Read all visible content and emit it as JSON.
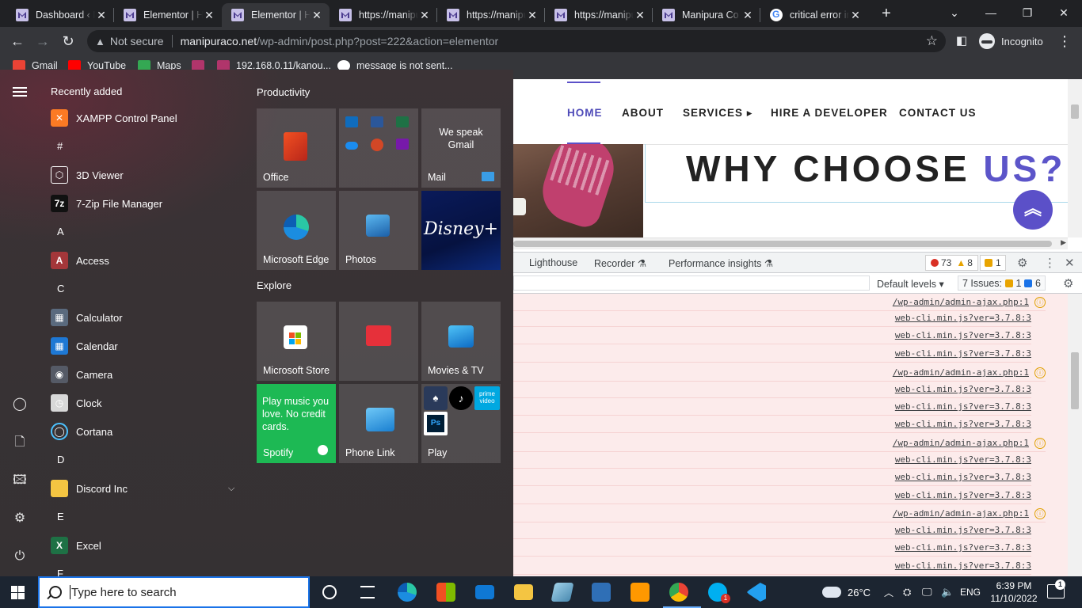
{
  "browser": {
    "tabs": [
      {
        "title": "Dashboard ‹ Manipura Co",
        "icon": "wordpress-icon"
      },
      {
        "title": "Elementor | Home",
        "icon": "wordpress-icon"
      },
      {
        "title": "Elementor | Home",
        "icon": "wordpress-icon"
      },
      {
        "title": "https://manipuraco.net",
        "icon": "wordpress-icon"
      },
      {
        "title": "https://manipuraco.net",
        "icon": "wordpress-icon"
      },
      {
        "title": "https://manipuraco.net",
        "icon": "wordpress-icon"
      },
      {
        "title": "Manipura Co",
        "icon": "wordpress-icon"
      },
      {
        "title": "critical error in WordPress",
        "icon": "google-icon"
      }
    ],
    "active_tab_index": 2,
    "not_secure_label": "Not secure",
    "url_domain": "manipuraco.net",
    "url_path": "/wp-admin/post.php?post=222&action=elementor",
    "incognito_label": "Incognito",
    "bookmarks": [
      {
        "label": "Gmail",
        "color": "#ea4335"
      },
      {
        "label": "YouTube",
        "color": "#ff0000"
      },
      {
        "label": "Maps",
        "color": "#34a853"
      },
      {
        "label": "",
        "color": "#b0356b"
      },
      {
        "label": "192.168.0.11/kanou...",
        "color": "#b0356b"
      },
      {
        "label": "message is not sent...",
        "color": "#ffffff"
      }
    ]
  },
  "website": {
    "nav": [
      "HOME",
      "ABOUT",
      "SERVICES",
      "HIRE A DEVELOPER",
      "CONTACT US"
    ],
    "services_arrow": "▸",
    "heading_main": "WHY CHOOSE ",
    "heading_accent": "US?",
    "back_to_top": "︽",
    "accent_color": "#5b50c8"
  },
  "devtools": {
    "tabs": [
      "Lighthouse",
      "Recorder",
      "Performance insights"
    ],
    "errors": "73",
    "warnings": "8",
    "issue_badge": "1",
    "default_levels": "Default levels ▾",
    "issues_label": "7 Issues:",
    "issues_warn": "1",
    "issues_info": "6",
    "rows": [
      {
        "text": "/wp-admin/admin-ajax.php:1",
        "kind": "ajax"
      },
      {
        "text": "web-cli.min.js?ver=3.7.8:3",
        "kind": "src"
      },
      {
        "text": "web-cli.min.js?ver=3.7.8:3",
        "kind": "src"
      },
      {
        "text": "web-cli.min.js?ver=3.7.8:3",
        "kind": "src"
      },
      {
        "text": "/wp-admin/admin-ajax.php:1",
        "kind": "ajax"
      },
      {
        "text": "web-cli.min.js?ver=3.7.8:3",
        "kind": "src"
      },
      {
        "text": "web-cli.min.js?ver=3.7.8:3",
        "kind": "src"
      },
      {
        "text": "web-cli.min.js?ver=3.7.8:3",
        "kind": "src"
      },
      {
        "text": "/wp-admin/admin-ajax.php:1",
        "kind": "ajax"
      },
      {
        "text": "web-cli.min.js?ver=3.7.8:3",
        "kind": "src"
      },
      {
        "text": "web-cli.min.js?ver=3.7.8:3",
        "kind": "src"
      },
      {
        "text": "web-cli.min.js?ver=3.7.8:3",
        "kind": "src"
      },
      {
        "text": "/wp-admin/admin-ajax.php:1",
        "kind": "ajax"
      },
      {
        "text": "web-cli.min.js?ver=3.7.8:3",
        "kind": "src"
      },
      {
        "text": "web-cli.min.js?ver=3.7.8:3",
        "kind": "src"
      },
      {
        "text": "web-cli.min.js?ver=3.7.8:3",
        "kind": "src"
      }
    ]
  },
  "start_menu": {
    "recently_added": "Recently added",
    "apps": [
      {
        "type": "app",
        "label": "XAMPP Control Panel",
        "icon": "xampp-icon",
        "color": "#fb7a24",
        "glyph": "✕"
      },
      {
        "type": "letter",
        "label": "#"
      },
      {
        "type": "app",
        "label": "3D Viewer",
        "icon": "cube-icon",
        "color": "transparent",
        "glyph": "⬡"
      },
      {
        "type": "app",
        "label": "7-Zip File Manager",
        "icon": "7zip-icon",
        "color": "#111111",
        "glyph": "7z"
      },
      {
        "type": "letter",
        "label": "A"
      },
      {
        "type": "app",
        "label": "Access",
        "icon": "access-icon",
        "color": "#a4373a",
        "glyph": "A"
      },
      {
        "type": "letter",
        "label": "C"
      },
      {
        "type": "app",
        "label": "Calculator",
        "icon": "calculator-icon",
        "color": "#5a6a7e",
        "glyph": "▦"
      },
      {
        "type": "app",
        "label": "Calendar",
        "icon": "calendar-icon",
        "color": "#1e78d4",
        "glyph": "▦"
      },
      {
        "type": "app",
        "label": "Camera",
        "icon": "camera-icon",
        "color": "#555a66",
        "glyph": "◉"
      },
      {
        "type": "app",
        "label": "Clock",
        "icon": "clock-icon",
        "color": "#d8d8d8",
        "glyph": "◷"
      },
      {
        "type": "app",
        "label": "Cortana",
        "icon": "cortana-icon",
        "color": "transparent",
        "glyph": "◯"
      },
      {
        "type": "letter",
        "label": "D"
      },
      {
        "type": "app",
        "label": "Discord Inc",
        "icon": "folder-icon",
        "color": "#f4c542",
        "glyph": ""
      },
      {
        "type": "letter",
        "label": "E"
      },
      {
        "type": "app",
        "label": "Excel",
        "icon": "excel-icon",
        "color": "#1e7145",
        "glyph": "X"
      },
      {
        "type": "letter",
        "label": "F"
      }
    ],
    "group_productivity": "Productivity",
    "group_explore": "Explore",
    "tiles": {
      "office": "Office",
      "mail_text": "We speak Gmail",
      "mail": "Mail",
      "edge": "Microsoft Edge",
      "photos": "Photos",
      "disney": "Disney+",
      "store": "Microsoft Store",
      "movies": "Movies & TV",
      "spotify_text": "Play music you love. No credit cards.",
      "spotify": "Spotify",
      "phone_link": "Phone Link",
      "play": "Play",
      "prime": "prime video",
      "ps": "Ps"
    }
  },
  "taskbar": {
    "search_placeholder": "Type here to search",
    "weather": "26°C",
    "language": "ENG",
    "time": "6:39 PM",
    "date": "11/10/2022",
    "notification_count": "1",
    "skype_badge": "1"
  }
}
